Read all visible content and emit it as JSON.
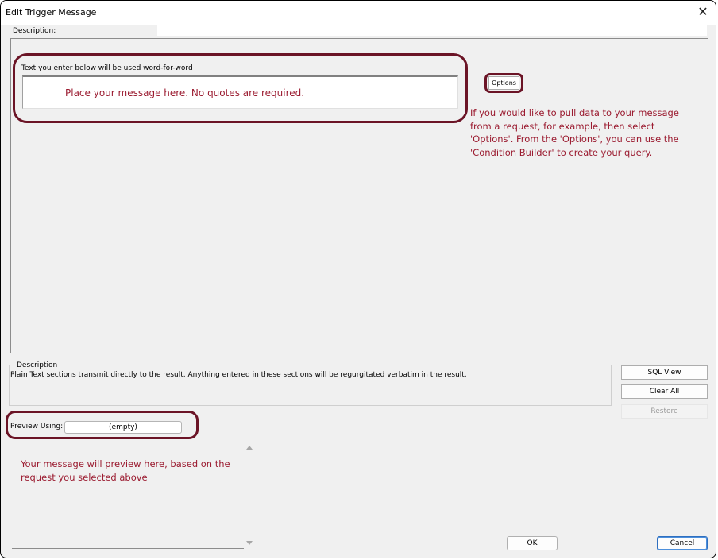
{
  "window": {
    "title": "Edit Trigger Message",
    "close_glyph": "✕"
  },
  "description": {
    "label": "Description:",
    "value": ""
  },
  "message": {
    "label": "Text you enter below will be used word-for-word",
    "placeholder": "Place your message here. No quotes are required."
  },
  "options_button": {
    "label": "Options"
  },
  "hint": "If you would like to pull data to your message from a request, for example, then select 'Options'. From the 'Options', you can use the 'Condition Builder' to create your query.",
  "lower_description": {
    "legend": "Description",
    "text": "Plain Text sections transmit directly to the result. Anything entered in these sections will be regurgitated verbatim in the result."
  },
  "side_buttons": {
    "sql_view": "SQL View",
    "clear_all": "Clear All",
    "restore": "Restore"
  },
  "preview": {
    "label": "Preview Using:",
    "value": "(empty)",
    "note": "Your message will preview here, based on the request you selected above"
  },
  "footer": {
    "ok": "OK",
    "cancel": "Cancel"
  },
  "colors": {
    "annotation_red": "#9b1b30",
    "highlight_border": "#6b1426",
    "default_button_border": "#2f6fbf"
  }
}
